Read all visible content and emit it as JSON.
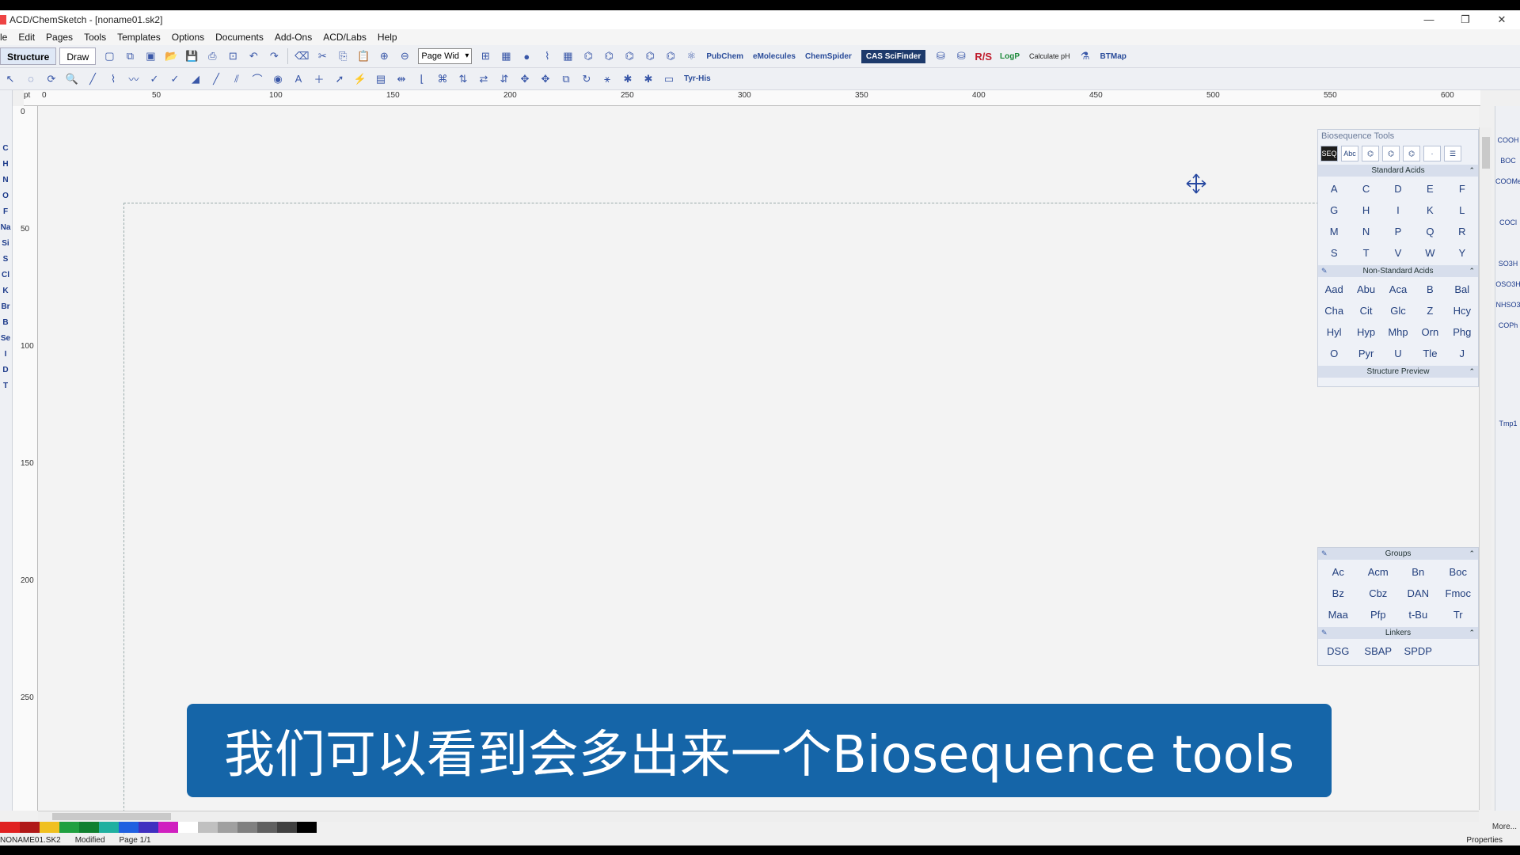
{
  "window": {
    "title": "ACD/ChemSketch - [noname01.sk2]",
    "controls": [
      "—",
      "❐",
      "✕"
    ]
  },
  "menu": [
    "le",
    "Edit",
    "Pages",
    "Tools",
    "Templates",
    "Options",
    "Documents",
    "Add-Ons",
    "ACD/Labs",
    "Help"
  ],
  "toolbar": {
    "tabs": [
      "Structure",
      "Draw"
    ],
    "zoom_select": "Page Wid",
    "links": [
      "PubChem",
      "eMolecules",
      "ChemSpider"
    ],
    "cas": "CAS SciFinder",
    "rs": "R/S",
    "logp": "LogP",
    "calc": "Calculate pH",
    "btmap": "BTMap",
    "tyr_his": "Tyr-His"
  },
  "left_tools": [
    "C",
    "H",
    "N",
    "O",
    "F",
    "Na",
    "Si",
    "S",
    "Cl",
    "K",
    "Br",
    "B",
    "Se",
    "I",
    "D",
    "T"
  ],
  "ruler": {
    "unit": "pt",
    "top_labels": [
      "0",
      "50",
      "100",
      "150",
      "200",
      "250",
      "300",
      "350",
      "400",
      "450",
      "500",
      "550",
      "600"
    ],
    "left_labels": [
      "0",
      "50",
      "100",
      "150",
      "200",
      "250"
    ]
  },
  "bio_panel": {
    "title": "Biosequence Tools",
    "icons": [
      "SEQ",
      "Abc",
      "ICON",
      "ICON",
      "ICON",
      "ICON",
      "ICON"
    ],
    "standard_title": "Standard Acids",
    "standard": [
      "A",
      "C",
      "D",
      "E",
      "F",
      "G",
      "H",
      "I",
      "K",
      "L",
      "M",
      "N",
      "P",
      "Q",
      "R",
      "S",
      "T",
      "V",
      "W",
      "Y"
    ],
    "nonstandard_title": "Non-Standard Acids",
    "nonstandard": [
      "Aad",
      "Abu",
      "Aca",
      "B",
      "Bal",
      "Cha",
      "Cit",
      "Glc",
      "Z",
      "Hcy",
      "Hyl",
      "Hyp",
      "Mhp",
      "Orn",
      "Phg",
      "O",
      "Pyr",
      "U",
      "Tle",
      "J"
    ],
    "preview_title": "Structure Preview"
  },
  "groups_panel": {
    "title": "Groups",
    "groups": [
      "Ac",
      "Acm",
      "Bn",
      "Boc",
      "Bz",
      "Cbz",
      "DAN",
      "Fmoc",
      "Maa",
      "Pfp",
      "t-Bu",
      "Tr"
    ],
    "linkers_title": "Linkers",
    "linkers": [
      "DSG",
      "SBAP",
      "SPDP"
    ]
  },
  "right_strip": [
    "COOH",
    "BOC",
    "COOMe",
    "COCl",
    "SO3H",
    "OSO3H",
    "NHSO3",
    "COPh",
    "Tmp1"
  ],
  "status": {
    "file": "NONAME01.SK2",
    "state": "Modified",
    "page": "Page 1/1",
    "more": "More...",
    "properties": "Properties"
  },
  "palette": [
    "#e02020",
    "#b01818",
    "#f0c020",
    "#20a040",
    "#108030",
    "#20b0a0",
    "#2060e0",
    "#4030c0",
    "#d020c0",
    "#c0c0c0",
    "#a0a0a0",
    "#808080",
    "#606060",
    "#404040",
    "#202020",
    "#000000"
  ],
  "subtitle": "我们可以看到会多出来一个Biosequence tools"
}
